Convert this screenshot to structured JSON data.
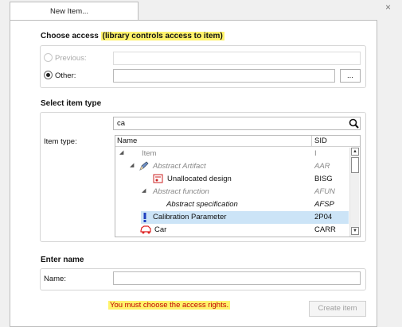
{
  "tab": {
    "label": "New Item...",
    "close_glyph": "×"
  },
  "access": {
    "title_main": "Choose access ",
    "title_highlight": "(library controls access to item)",
    "previous_label": "Previous:",
    "previous_value": "",
    "other_label": "Other:",
    "other_value": "",
    "browse_label": "..."
  },
  "item_type_section": {
    "title": "Select item type",
    "search_value": "ca",
    "search_icon": "search-icon",
    "label": "Item type:",
    "columns": {
      "name": "Name",
      "sid": "SID"
    },
    "rows": [
      {
        "name": "Item",
        "sid": "I",
        "toggle": "◢",
        "icon": "",
        "style": "gray"
      },
      {
        "name": "Abstract Artifact",
        "sid": "AAR",
        "toggle": "◢",
        "icon": "pencil-icon",
        "style": "gray-italic"
      },
      {
        "name": "Unallocated design",
        "sid": "BISG",
        "toggle": "",
        "icon": "design-icon",
        "style": "normal"
      },
      {
        "name": "Abstract function",
        "sid": "AFUN",
        "toggle": "◢",
        "icon": "",
        "style": "gray-italic"
      },
      {
        "name": "Abstract specification",
        "sid": "AFSP",
        "toggle": "",
        "icon": "",
        "style": "italic"
      },
      {
        "name": "Calibration Parameter",
        "sid": "2P04",
        "toggle": "",
        "icon": "exclamation-icon",
        "style": "selected"
      },
      {
        "name": "Car",
        "sid": "CARR",
        "toggle": "",
        "icon": "car-icon",
        "style": "normal"
      }
    ]
  },
  "name_section": {
    "title": "Enter name",
    "label": "Name:",
    "value": ""
  },
  "footer": {
    "message": "You must choose the access rights.",
    "create_label": "Create item"
  },
  "colors": {
    "highlight": "#fff36b",
    "error": "#c00000",
    "selection": "#cce4f7"
  }
}
